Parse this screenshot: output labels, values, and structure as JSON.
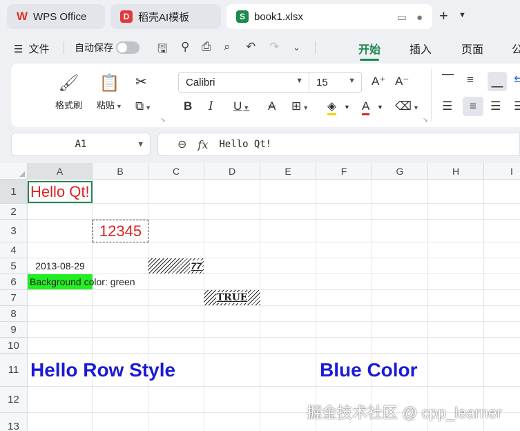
{
  "tabs": {
    "wps": "WPS Office",
    "template": "稻壳AI模板",
    "book": "book1.xlsx"
  },
  "menu": {
    "file": "文件",
    "autosave": "自动保存",
    "tab_start": "开始",
    "tab_insert": "插入",
    "tab_page": "页面",
    "tab_more": "公"
  },
  "ribbon": {
    "format_painter": "格式刷",
    "paste": "粘贴",
    "font_name": "Calibri",
    "font_size": "15"
  },
  "formula": {
    "cell_ref": "A1",
    "fx": "fx",
    "value": "Hello Qt!"
  },
  "grid": {
    "columns": [
      "A",
      "B",
      "C",
      "D",
      "E",
      "F",
      "G",
      "H",
      "I"
    ],
    "rows": [
      "1",
      "2",
      "3",
      "4",
      "5",
      "6",
      "7",
      "8",
      "9",
      "10",
      "11",
      "12",
      "13"
    ],
    "cells": {
      "a1": "Hello Qt!",
      "b3": "12345",
      "a5": "2013-08-29",
      "c5": "77",
      "a6": "Background color: green",
      "d7": "TRUE",
      "a11": "Hello Row Style",
      "f11": "Blue Color"
    }
  },
  "watermark": "掘金技术社区 @ cpp_learner",
  "colors": {
    "accent": "#1b8a4b",
    "red_text": "#e02020",
    "blue_text": "#1a1ad6",
    "green_fill": "#22ee22"
  }
}
